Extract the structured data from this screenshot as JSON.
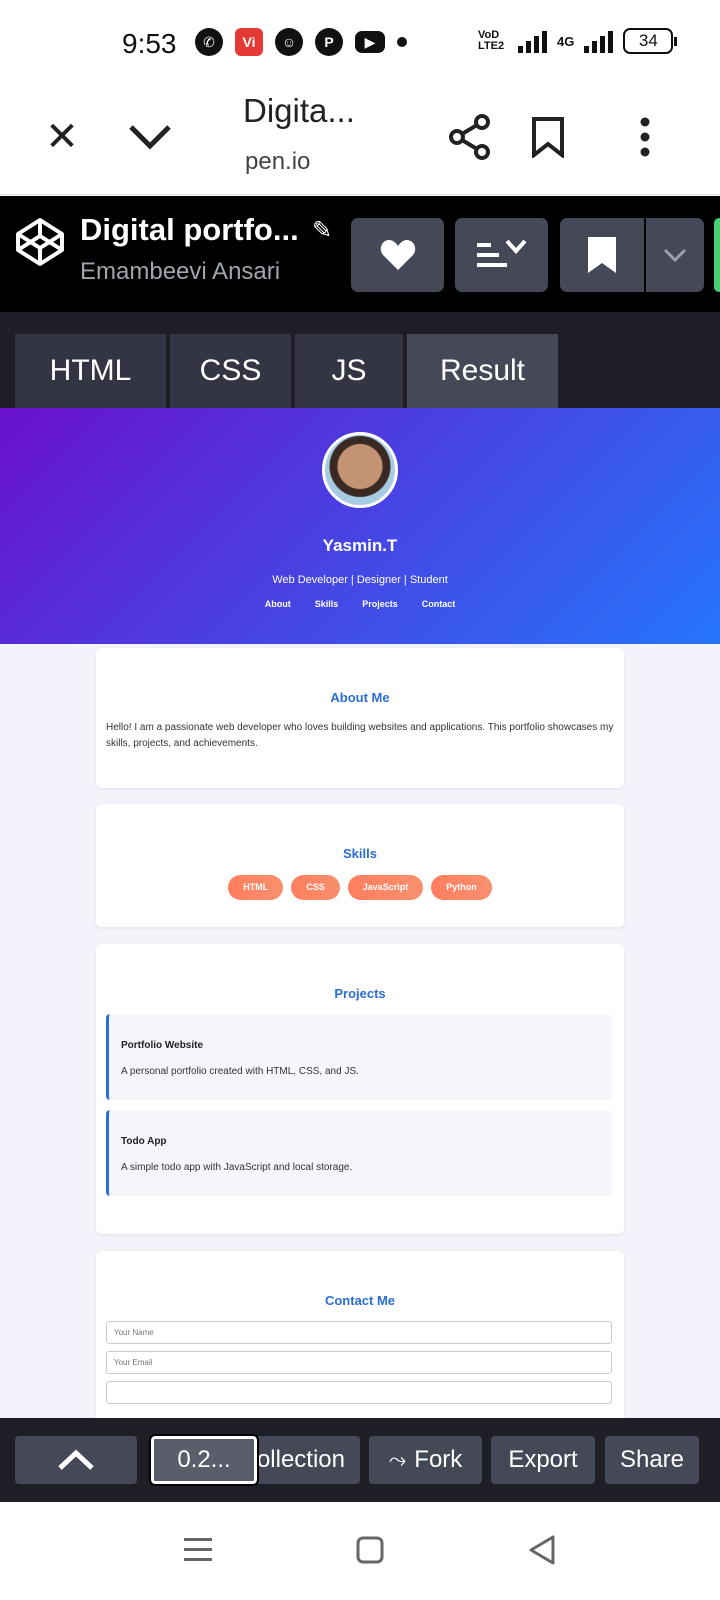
{
  "status": {
    "time": "9:53",
    "network_label": "VoD LTE2",
    "network_type": "4G",
    "battery": "34"
  },
  "browser": {
    "title": "Digita...",
    "url": "pen.io"
  },
  "codepen": {
    "pen_title": "Digital portfo...",
    "author": "Emambeevi Ansari",
    "tabs": [
      {
        "label": "HTML"
      },
      {
        "label": "CSS"
      },
      {
        "label": "JS"
      },
      {
        "label": "Result"
      }
    ],
    "bottom": {
      "zoom": "0.2...",
      "collection": "ollection",
      "fork": "Fork",
      "export": "Export",
      "share": "Share"
    }
  },
  "portfolio": {
    "name": "Yasmin.T",
    "tagline": "Web Developer | Designer | Student",
    "nav": [
      "About",
      "Skills",
      "Projects",
      "Contact"
    ],
    "about": {
      "heading": "About Me",
      "text": "Hello! I am a passionate web developer who loves building websites and applications. This portfolio showcases my skills, projects, and achievements."
    },
    "skills": {
      "heading": "Skills",
      "items": [
        "HTML",
        "CSS",
        "JavaScript",
        "Python"
      ]
    },
    "projects": {
      "heading": "Projects",
      "items": [
        {
          "title": "Portfolio Website",
          "desc": "A personal portfolio created with HTML, CSS, and JS."
        },
        {
          "title": "Todo App",
          "desc": "A simple todo app with JavaScript and local storage."
        }
      ]
    },
    "contact": {
      "heading": "Contact Me",
      "name_placeholder": "Your Name",
      "email_placeholder": "Your Email"
    }
  },
  "colors": {
    "gradient_start": "#6a11cb",
    "gradient_end": "#2575fc",
    "heading_blue": "#2a6ed6",
    "pill": "#ff7e5f",
    "codepen_bar": "#1e1f26"
  }
}
